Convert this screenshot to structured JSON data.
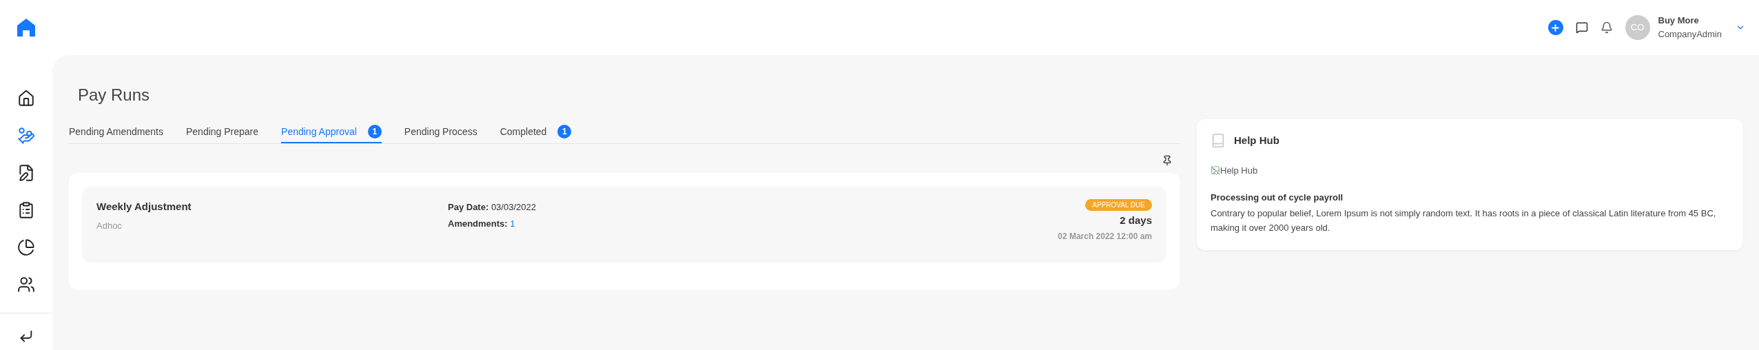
{
  "header": {
    "user": {
      "initials": "CO",
      "name": "Buy More",
      "role": "CompanyAdmin"
    }
  },
  "sidebar": {
    "items": [
      {
        "kind": "home",
        "selected": false
      },
      {
        "kind": "payroll",
        "selected": true
      },
      {
        "kind": "notes",
        "selected": false
      },
      {
        "kind": "invoice",
        "selected": false
      },
      {
        "kind": "reports",
        "selected": false
      },
      {
        "kind": "people",
        "selected": false
      }
    ]
  },
  "page": {
    "title": "Pay Runs"
  },
  "tabs": [
    {
      "label": "Pending Amendments",
      "selected": false
    },
    {
      "label": "Pending Prepare",
      "selected": false
    },
    {
      "label": "Pending Approval",
      "selected": true,
      "count": "1"
    },
    {
      "label": "Pending Process",
      "selected": false
    },
    {
      "label": "Completed",
      "selected": false,
      "count": "1"
    }
  ],
  "pay_runs": [
    {
      "name": "Weekly Adjustment",
      "type": "Adhoc",
      "pay_date_label": "Pay Date:",
      "pay_date": "03/03/2022",
      "amendments_label": "Amendments:",
      "amendments": "1",
      "status": "APPROVAL DUE",
      "due_in": "2 days",
      "due_date": "02 March 2022 12:00 am"
    }
  ],
  "help_hub": {
    "title": "Help Hub",
    "image_alt": "Help Hub",
    "article_title": "Processing out of cycle payroll",
    "article_text": "Contrary to popular belief, Lorem Ipsum is not simply random text. It has roots in a piece of classical Latin literature from 45 BC, making it over 2000 years old."
  }
}
